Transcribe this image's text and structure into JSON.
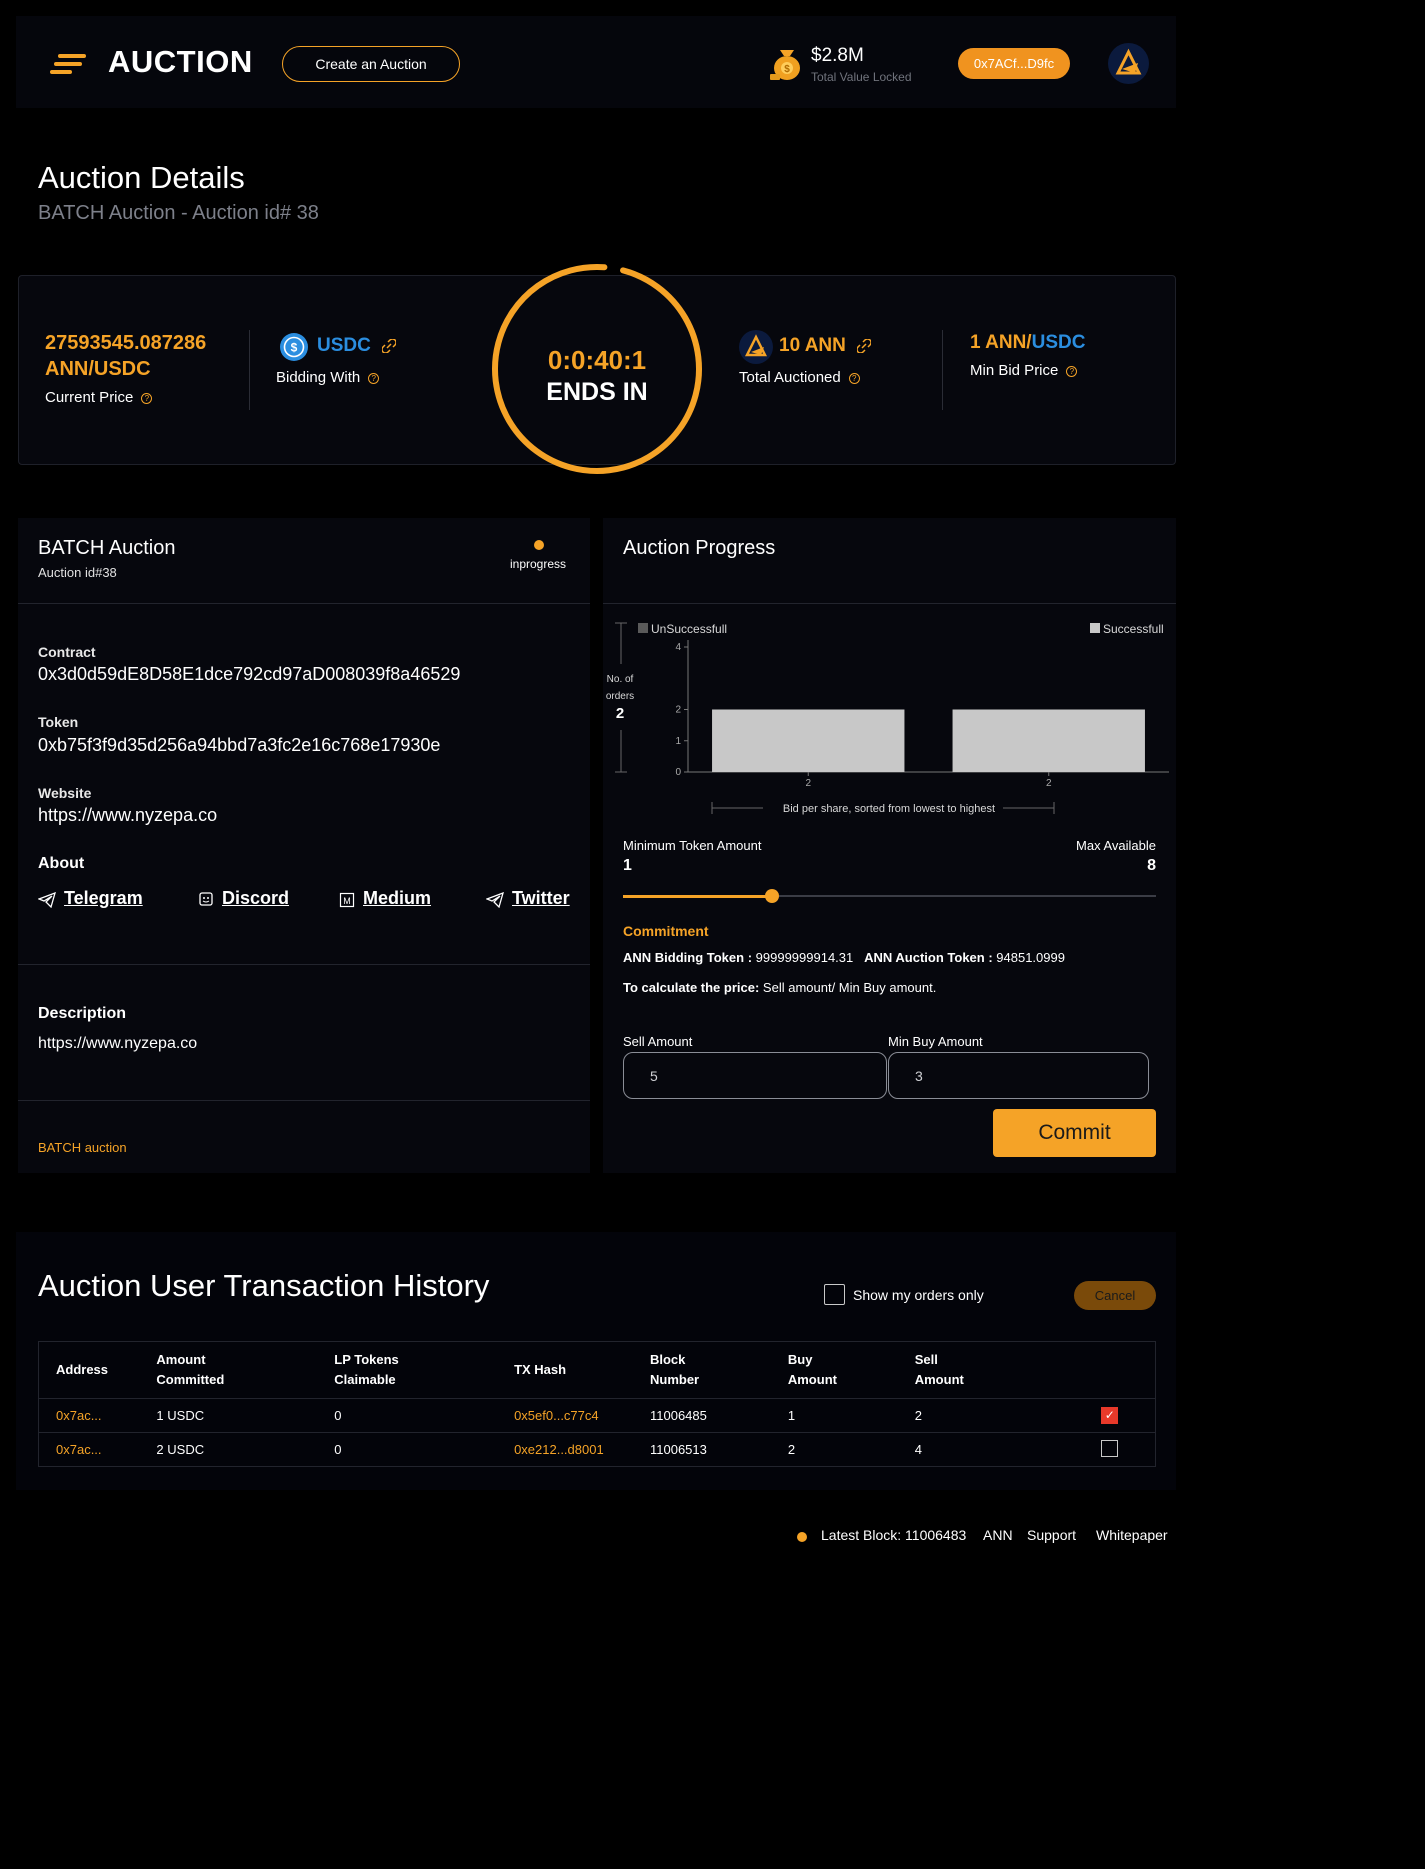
{
  "header": {
    "logo": "AUCTION",
    "create_button": "Create an Auction",
    "tvl_value": "$2.8M",
    "tvl_label": "Total Value Locked",
    "wallet": "0x7ACf...D9fc"
  },
  "page": {
    "title": "Auction Details",
    "subtitle": "BATCH Auction - Auction id# 38"
  },
  "stats": {
    "current_price_value": "27593545.087286",
    "current_price_pair": "ANN/USDC",
    "current_price_label": "Current Price",
    "bidding_token": "USDC",
    "bidding_label": "Bidding With",
    "timer": "0:0:40:1",
    "ends_in": "ENDS IN",
    "total_auctioned": "10 ANN",
    "total_auctioned_label": "Total Auctioned",
    "min_bid_base": "1 ANN/",
    "min_bid_quote": "USDC",
    "min_bid_label": "Min Bid Price",
    "timer_progress": 0.97
  },
  "batch": {
    "title": "BATCH Auction",
    "auction_id": "Auction id#38",
    "status": "inprogress",
    "contract_label": "Contract",
    "contract": "0x3d0d59dE8D58E1dce792cd97aD008039f8a46529",
    "token_label": "Token",
    "token": "0xb75f3f9d35d256a94bbd7a3fc2e16c768e17930e",
    "website_label": "Website",
    "website": "https://www.nyzepa.co",
    "about_label": "About",
    "socials": [
      "Telegram",
      "Discord",
      "Medium",
      "Twitter"
    ],
    "description_label": "Description",
    "description": "https://www.nyzepa.co",
    "footer_tag": "BATCH auction"
  },
  "progress": {
    "title": "Auction Progress",
    "min_token_label": "Minimum Token Amount",
    "min_token_value": "1",
    "max_label": "Max Available",
    "max_value": "8",
    "slider_fraction": 0.28,
    "commitment_label": "Commitment",
    "bidding_token_label": "ANN Bidding Token :",
    "bidding_token_value": "99999999914.31",
    "auction_token_label": "ANN Auction Token :",
    "auction_token_value": "94851.0999",
    "calc_label": "To calculate the price:",
    "calc_text": "Sell amount/ Min Buy amount.",
    "sell_label": "Sell Amount",
    "sell_value": "5",
    "min_buy_label": "Min Buy Amount",
    "min_buy_value": "3",
    "commit_button": "Commit"
  },
  "chart_data": {
    "type": "bar",
    "categories": [
      "2",
      "2"
    ],
    "series": [
      {
        "name": "Successfull",
        "values": [
          2,
          2
        ]
      }
    ],
    "legend": [
      "UnSuccessfull",
      "Successfull"
    ],
    "ylabel_line1": "No. of",
    "ylabel_line2": "orders",
    "ylabel_value": "2",
    "xlabel": "Bid per share, sorted from lowest to highest",
    "yticks": [
      "0",
      "1",
      "2",
      "4"
    ],
    "ylim": [
      0,
      4
    ],
    "colors": {
      "successful": "#c8c8c8",
      "unsuccessful": "#5a5a5a"
    }
  },
  "history": {
    "title": "Auction User Transaction History",
    "show_mine_label": "Show my orders only",
    "cancel_button": "Cancel",
    "columns": [
      [
        "Address"
      ],
      [
        "Amount",
        "Committed"
      ],
      [
        "LP Tokens",
        "Claimable"
      ],
      [
        "TX Hash"
      ],
      [
        "Block",
        "Number"
      ],
      [
        "Buy",
        "Amount"
      ],
      [
        "Sell",
        "Amount"
      ]
    ],
    "rows": [
      {
        "address": "0x7ac...",
        "amount": "1 USDC",
        "lp": "0",
        "tx": "0x5ef0...c77c4",
        "block": "11006485",
        "buy": "1",
        "sell": "2",
        "checked": true
      },
      {
        "address": "0x7ac...",
        "amount": "2 USDC",
        "lp": "0",
        "tx": "0xe212...d8001",
        "block": "11006513",
        "buy": "2",
        "sell": "4",
        "checked": false
      }
    ]
  },
  "footer": {
    "latest_block": "Latest Block: 11006483",
    "links": [
      "ANN",
      "Support",
      "Whitepaper"
    ]
  },
  "colors": {
    "accent": "#f5a327",
    "blue": "#2b8ee0",
    "background": "#000000",
    "panel": "#06070d"
  }
}
